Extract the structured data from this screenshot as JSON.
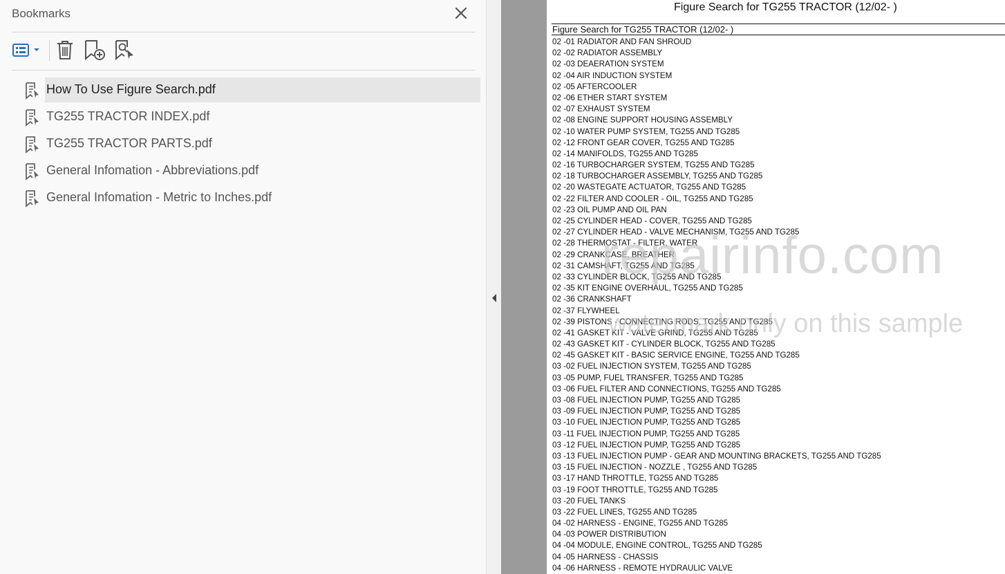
{
  "bookmarks_panel": {
    "title": "Bookmarks",
    "close_icon": "close-icon",
    "toolbar": {
      "options_icon": "bookmark-options-icon",
      "delete_icon": "trash-icon",
      "new_bookmark_icon": "new-bookmark-icon",
      "find_bookmark_icon": "find-current-bookmark-icon"
    },
    "items": [
      {
        "label": "How To Use Figure Search.pdf",
        "selected": true
      },
      {
        "label": "TG255 TRACTOR INDEX.pdf",
        "selected": false
      },
      {
        "label": "TG255 TRACTOR PARTS.pdf",
        "selected": false
      },
      {
        "label": "General Infomation - Abbreviations.pdf",
        "selected": false
      },
      {
        "label": "General Infomation - Metric to Inches.pdf",
        "selected": false
      }
    ]
  },
  "splitter": {
    "icon": "collapse-left-arrow-icon"
  },
  "document": {
    "title": "Figure Search for TG255 TRACTOR (12/02- )",
    "header": "Figure Search for TG255 TRACTOR (12/02- )",
    "rows": [
      "02 -01 RADIATOR AND FAN SHROUD",
      "02 -02 RADIATOR ASSEMBLY",
      "02 -03 DEAERATION SYSTEM",
      "02 -04 AIR INDUCTION SYSTEM",
      "02 -05 AFTERCOOLER",
      "02 -06 ETHER START SYSTEM",
      "02 -07 EXHAUST SYSTEM",
      "02 -08 ENGINE SUPPORT HOUSING ASSEMBLY",
      "02 -10 WATER PUMP SYSTEM, TG255 AND TG285",
      "02 -12 FRONT GEAR COVER, TG255 AND TG285",
      "02 -14 MANIFOLDS, TG255 AND TG285",
      "02 -16 TURBOCHARGER SYSTEM, TG255 AND TG285",
      "02 -18 TURBOCHARGER ASSEMBLY, TG255 AND TG285",
      "02 -20 WASTEGATE ACTUATOR, TG255 AND TG285",
      "02 -22 FILTER AND COOLER - OIL, TG255 AND TG285",
      "02 -23 OIL PUMP AND OIL PAN",
      "02 -25 CYLINDER HEAD - COVER, TG255 AND TG285",
      "02 -27 CYLINDER HEAD - VALVE MECHANISM, TG255 AND TG285",
      "02 -28 THERMOSTAT - FILTER, WATER",
      "02 -29 CRANKCASE, BREATHER",
      "02 -31 CAMSHAFT, TG255 AND TG285",
      "02 -33 CYLINDER BLOCK, TG255 AND TG285",
      "02 -35 KIT ENGINE OVERHAUL, TG255 AND TG285",
      "02 -36 CRANKSHAFT",
      "02 -37 FLYWHEEL",
      "02 -39 PISTONS - CONNECTING RODS, TG255 AND TG285",
      "02 -41 GASKET KIT - VALVE GRIND, TG255 AND TG285",
      "02 -43 GASKET KIT - CYLINDER BLOCK, TG255 AND TG285",
      "02 -45 GASKET KIT - BASIC SERVICE ENGINE, TG255 AND TG285",
      "03 -02 FUEL INJECTION SYSTEM, TG255 AND TG285",
      "03 -05 PUMP, FUEL TRANSFER, TG255 AND TG285",
      "03 -06 FUEL FILTER AND CONNECTIONS, TG255 AND TG285",
      "03 -08 FUEL INJECTION PUMP, TG255 AND TG285",
      "03 -09 FUEL INJECTION PUMP, TG255 AND TG285",
      "03 -10 FUEL INJECTION PUMP, TG255 AND TG285",
      "03 -11 FUEL INJECTION PUMP, TG255 AND TG285",
      "03 -12 FUEL INJECTION PUMP, TG255 AND TG285",
      "03 -13 FUEL INJECTION PUMP - GEAR AND MOUNTING BRACKETS, TG255 AND TG285",
      "03 -15 FUEL INJECTION - NOZZLE , TG255 AND TG285",
      "03 -17 HAND THROTTLE, TG255 AND TG285",
      "03 -19 FOOT THROTTLE, TG255 AND TG285",
      "03 -20 FUEL TANKS",
      "03 -22 FUEL LINES, TG255 AND TG285",
      "04 -02 HARNESS - ENGINE, TG255 AND TG285",
      "04 -03 POWER DISTRIBUTION",
      "04 -04 MODULE, ENGINE CONTROL, TG255 AND TG285",
      "04 -05 HARNESS - CHASSIS",
      "04 -06 HARNESS - REMOTE HYDRAULIC VALVE"
    ]
  },
  "watermark": {
    "line1": "repairinfo.com",
    "line2": "watermark only on this sample"
  },
  "colors": {
    "accent": "#2a6ebb",
    "panel_bg": "#f9f9f9",
    "selected_bg": "#e6e6e6",
    "doc_gutter": "#9b9b9b"
  }
}
